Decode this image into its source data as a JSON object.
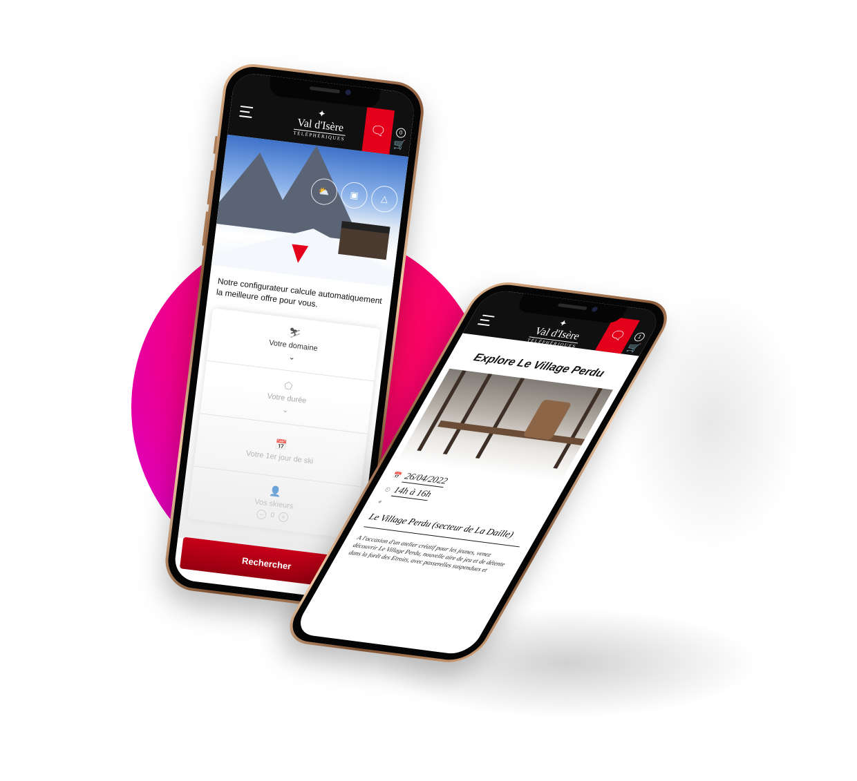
{
  "brand": {
    "accent": "#e4001b",
    "logo_mark": "✦",
    "logo_title": "Val d'Isère",
    "logo_subtitle": "TÉLÉPHÉRIQUES"
  },
  "phone1": {
    "cart_count": "0",
    "hero_icons": [
      "cloud-sun-icon",
      "gondola-icon",
      "mountain-icon"
    ],
    "intro_text": "Notre configurateur calcule automatiquement la meilleure offre pour vous.",
    "config": {
      "domain_label": "Votre domaine",
      "duration_label": "Votre durée",
      "first_day_label": "Votre 1er jour de ski",
      "skiers_label": "Vos skieurs",
      "skiers_count": "0",
      "minus": "−",
      "plus": "+"
    },
    "search_button": "Rechercher"
  },
  "phone2": {
    "cart_count": "1",
    "title": "Explore Le Village Perdu",
    "date": "26/04/2022",
    "time": "14h à 16h",
    "place": "Le Village Perdu (secteur de La Daille)",
    "description": "A l'occasion d'un atelier créatif pour les jeunes, venez découvrir Le Village Perdu, nouvelle aire de jeu et de détente dans la forêt des Etroits, avec passerelles suspendues et"
  }
}
